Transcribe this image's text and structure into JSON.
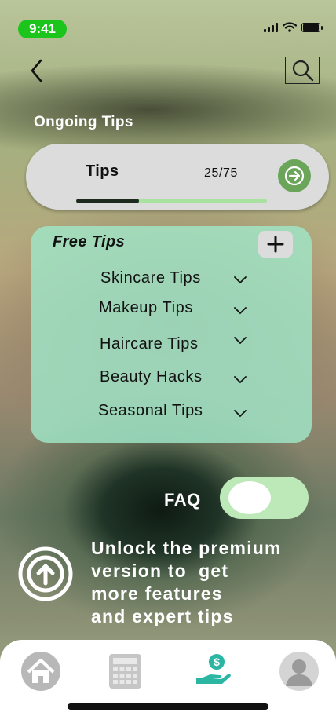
{
  "status_bar": {
    "time": "9:41",
    "icons": [
      "signal-icon",
      "wifi-icon",
      "battery-icon"
    ]
  },
  "header": {
    "back_icon": "chevron-left-icon",
    "search_icon": "search-icon"
  },
  "ongoing": {
    "title": "Ongoing Tips",
    "card_label": "Tips",
    "count": "25/75",
    "progress": 0.33,
    "go_icon": "arrow-right-icon"
  },
  "free_tips": {
    "title": "Free Tips",
    "add_icon": "plus-icon",
    "items": [
      {
        "label": "Skincare Tips"
      },
      {
        "label": "Makeup Tips"
      },
      {
        "label": "Haircare Tips"
      },
      {
        "label": "Beauty Hacks"
      },
      {
        "label": "Seasonal Tips"
      }
    ]
  },
  "faq": {
    "label": "FAQ",
    "toggle_on": false
  },
  "premium": {
    "icon": "upgrade-arrow-icon",
    "lines": [
      "Unlock the premium",
      "version to  get",
      "more features",
      "and expert tips"
    ]
  },
  "bottom_nav": {
    "items": [
      {
        "name": "home-icon"
      },
      {
        "name": "calculator-icon"
      },
      {
        "name": "money-hand-icon"
      },
      {
        "name": "profile-icon"
      }
    ]
  },
  "colors": {
    "accent_green": "#6aa55a",
    "status_green": "#1cc51c",
    "card_mint": "#a0e6c8",
    "progress_track": "#a9e2a0",
    "toggle_bg": "#bde9b8"
  }
}
